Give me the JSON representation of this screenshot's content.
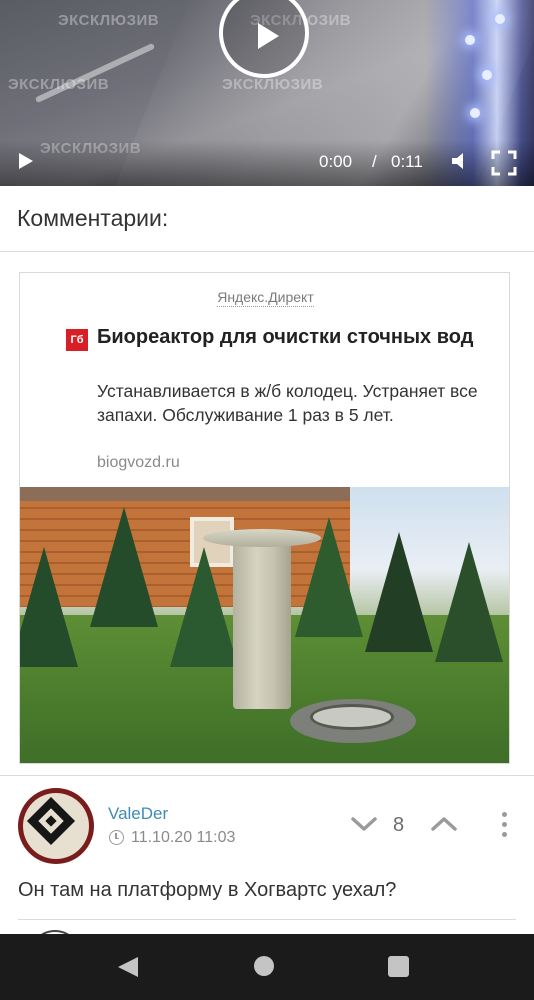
{
  "video": {
    "watermark": "ЭКСКЛЮЗИВ",
    "current_time": "0:00",
    "separator": "/",
    "duration": "0:11",
    "icons": [
      "play-icon",
      "volume-icon",
      "fullscreen-icon"
    ]
  },
  "comments_header": {
    "title": "Комментарии:"
  },
  "ad": {
    "source": "Яндекс.Директ",
    "favicon_text": "Гб",
    "title": "Биореактор для очистки сточных вод",
    "text": "Устанавливается в ж/б колодец. Устраняет все запахи. Обслуживание 1 раз в 5 лет.",
    "domain": "biogvozd.ru"
  },
  "comment": {
    "author": "ValeDer",
    "date": "11.10.20 11:03",
    "rating": "8",
    "text": "Он там на платформу в Хогвартс уехал?"
  },
  "colors": {
    "author_link": "#3f8bb3",
    "ad_favicon_bg": "#d81f26",
    "navbar_bg": "#1b1b1b"
  }
}
